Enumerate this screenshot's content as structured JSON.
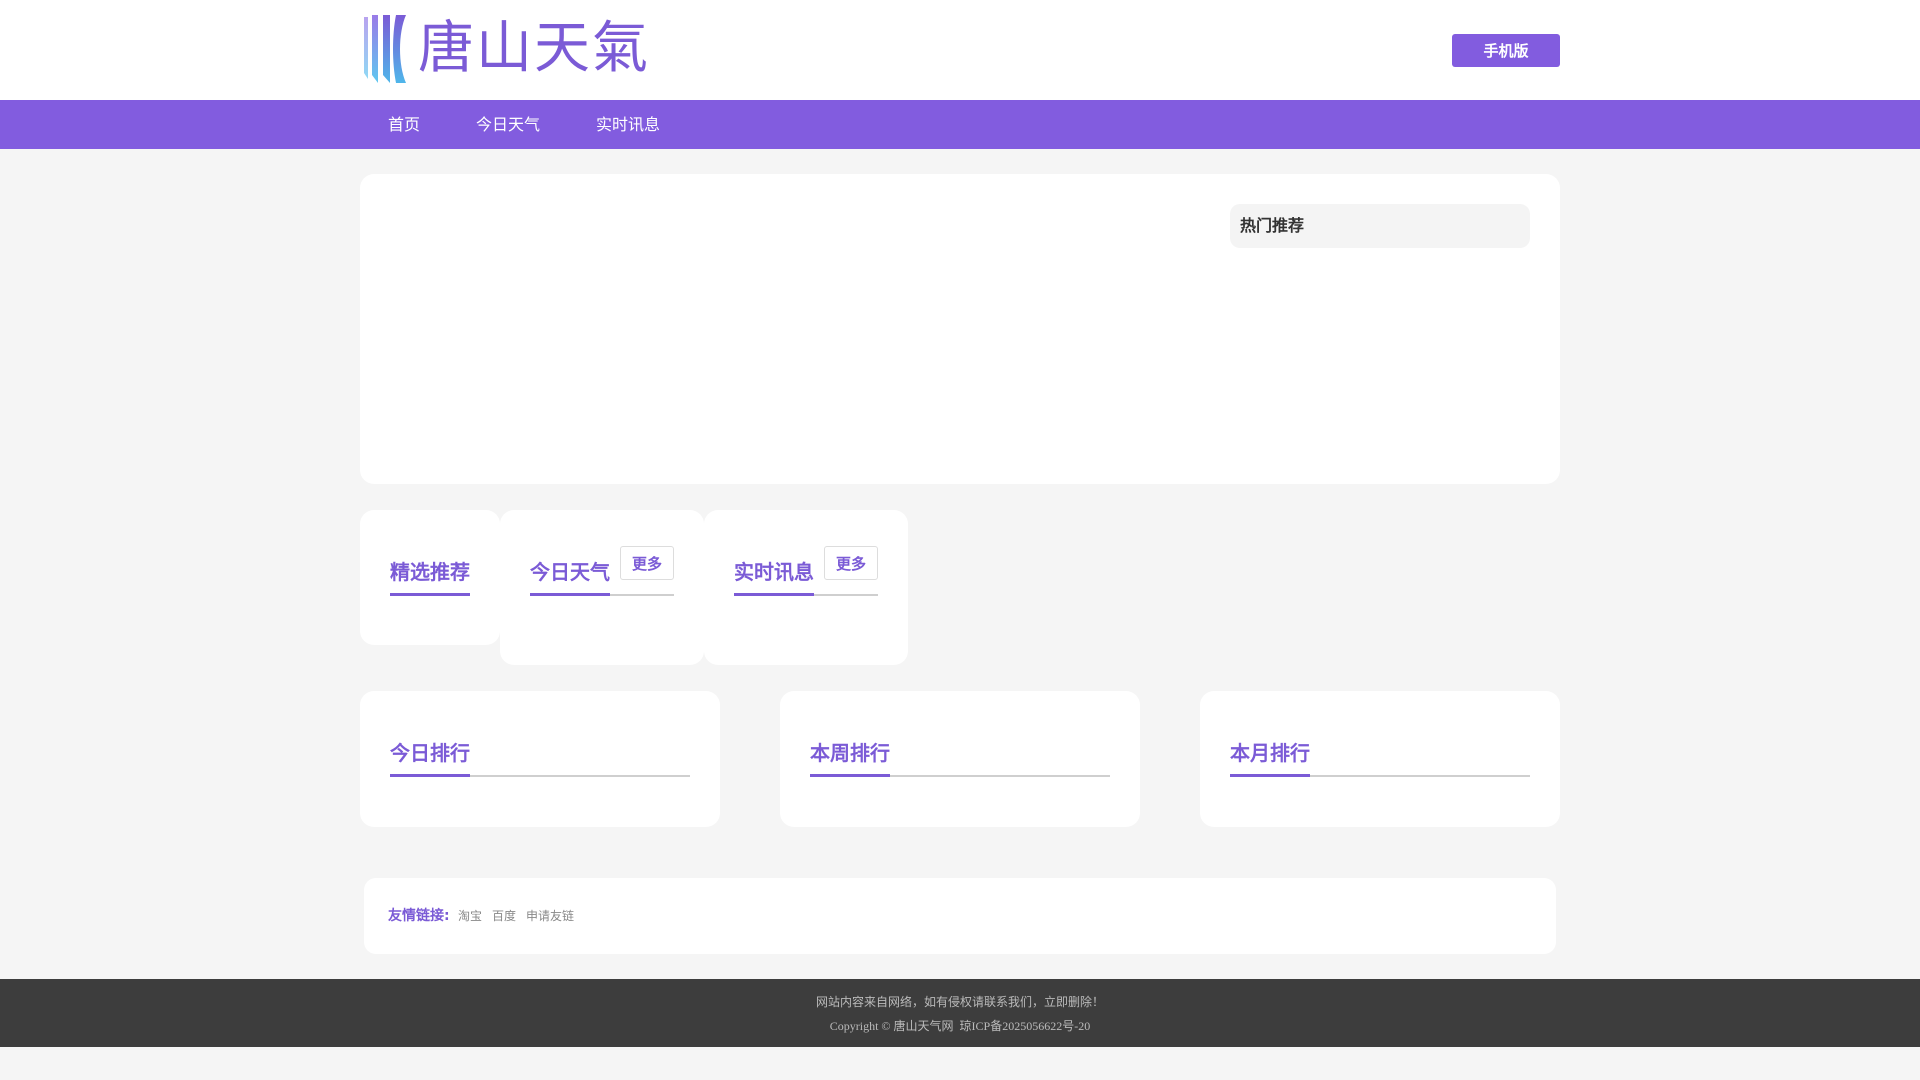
{
  "site": {
    "logo_text": "唐山天氣",
    "mobile_label": "手机版"
  },
  "nav": {
    "items": [
      {
        "label": "首页"
      },
      {
        "label": "今日天气"
      },
      {
        "label": "实时讯息"
      }
    ]
  },
  "sidebar": {
    "hot_title": "热门推荐"
  },
  "sections": {
    "featured": "精选推荐",
    "today_weather": "今日天气",
    "realtime_news": "实时讯息",
    "more_label": "更多"
  },
  "rankings": {
    "today": "今日排行",
    "week": "本周排行",
    "month": "本月排行"
  },
  "friend_links": {
    "label": "友情链接:",
    "items": [
      "淘宝",
      "百度",
      "申请友链"
    ]
  },
  "footer": {
    "notice": "网站内容来自网络，如有侵权请联系我们，立即删除！",
    "copyright": "Copyright © 唐山天气网  琼ICP备2025056622号-20"
  },
  "colors": {
    "accent": "#825cdf",
    "footer_bg": "#3d3d3d"
  }
}
